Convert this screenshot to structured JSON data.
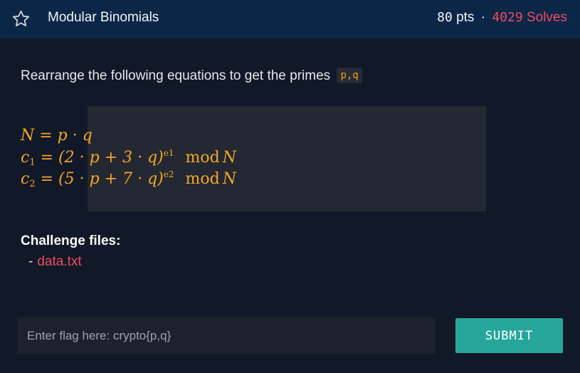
{
  "header": {
    "title": "Modular Binomials",
    "points": "80",
    "points_unit": "pts",
    "separator": "·",
    "solves": "4029",
    "solves_unit": "Solves",
    "star_icon": "star-outline-icon"
  },
  "description": {
    "text": "Rearrange the following equations to get the primes",
    "code": "p,q"
  },
  "equations": {
    "eq1": {
      "lhs": "N",
      "eq": " = ",
      "rhs": "p · q"
    },
    "eq2": {
      "lhs": "c",
      "sub": "1",
      "eq": " = ",
      "rhs": "(2 · p + 3 · q)",
      "sup": "e1",
      "mod": "mod",
      "modulus": "N"
    },
    "eq3": {
      "lhs": "c",
      "sub": "2",
      "eq": " = ",
      "rhs": "(5 · p + 7 · q)",
      "sup": "e2",
      "mod": "mod",
      "modulus": "N"
    }
  },
  "files": {
    "label": "Challenge files:",
    "bullet": "-",
    "items": [
      "data.txt"
    ]
  },
  "flag": {
    "placeholder": "Enter flag here: crypto{p,q}",
    "value": "",
    "submit_label": "SUBMIT"
  },
  "colors": {
    "header_bg": "#0b2748",
    "page_bg": "#111827",
    "accent_red": "#ef4b5f",
    "math_orange": "#f5a623",
    "submit_teal": "#26a69a"
  }
}
